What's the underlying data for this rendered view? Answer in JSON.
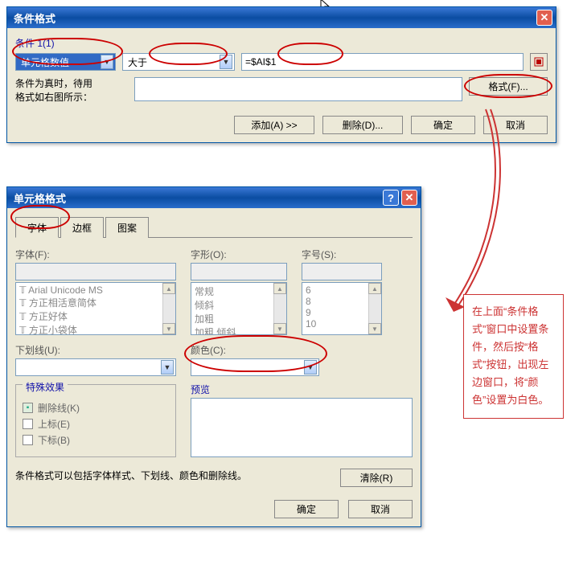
{
  "cond_dialog": {
    "title": "条件格式",
    "condition_label": "条件 1(1)",
    "combo1": "单元格数值",
    "combo2": "大于",
    "formula": "=$AI$1",
    "hint_line1": "条件为真时，待用",
    "hint_line2": "格式如右图所示：",
    "format_btn": "格式(F)...",
    "add_btn": "添加(A) >>",
    "delete_btn": "删除(D)...",
    "ok_btn": "确定",
    "cancel_btn": "取消"
  },
  "cell_dialog": {
    "title": "单元格格式",
    "tabs": {
      "font": "字体",
      "border": "边框",
      "pattern": "图案"
    },
    "font_label": "字体(F):",
    "style_label": "字形(O):",
    "size_label": "字号(S):",
    "fonts": [
      "Arial Unicode MS",
      "方正相活意简体",
      "方正好体",
      "方正小袋体"
    ],
    "styles": [
      "常规",
      "倾斜",
      "加粗",
      "加粗 倾斜"
    ],
    "sizes": [
      "6",
      "8",
      "9",
      "10"
    ],
    "underline_label": "下划线(U):",
    "color_label": "颜色(C):",
    "effects_label": "特殊效果",
    "strike": "删除线(K)",
    "super": "上标(E)",
    "sub": "下标(B)",
    "preview_label": "预览",
    "desc": "条件格式可以包括字体样式、下划线、颜色和删除线。",
    "clear_btn": "清除(R)",
    "ok_btn": "确定",
    "cancel_btn": "取消"
  },
  "annotation": "在上面“条件格式”窗口中设置条件，然后按“格式”按钮，出现左边窗口，将“颜色”设置为白色。"
}
